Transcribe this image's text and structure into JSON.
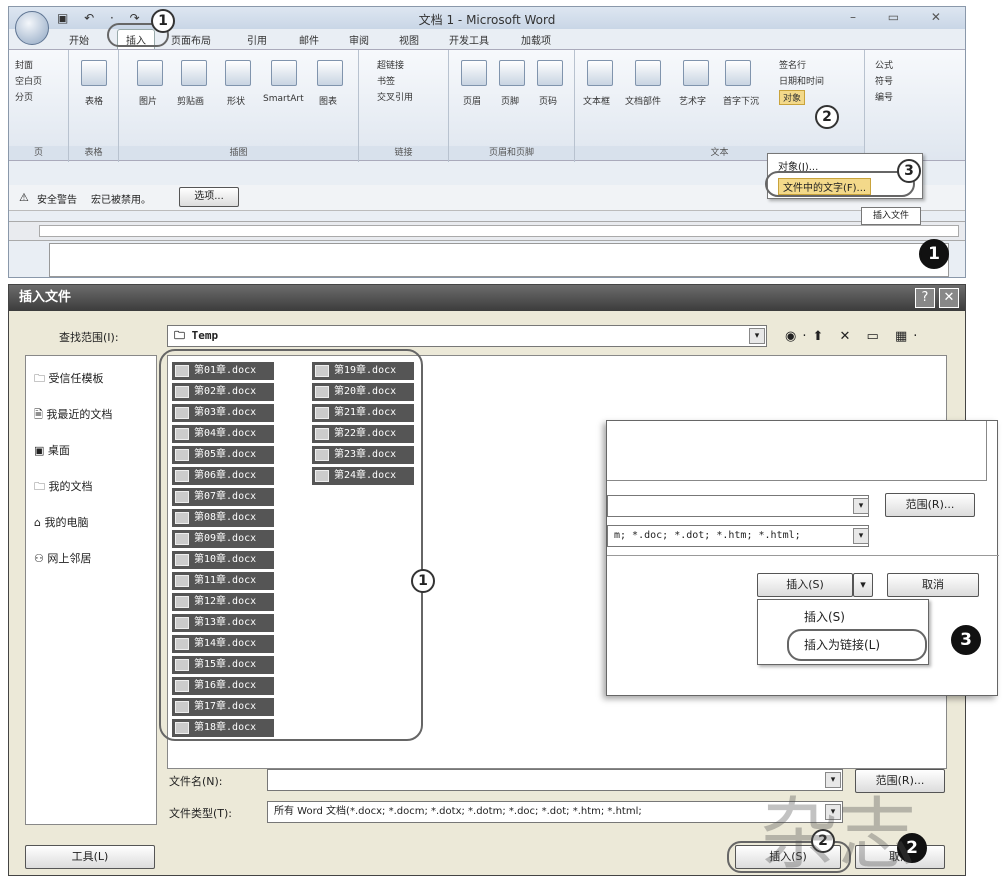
{
  "word": {
    "title": "文档 1 - Microsoft Word",
    "tabs": [
      "开始",
      "插入",
      "页面布局",
      "引用",
      "邮件",
      "审阅",
      "视图",
      "开发工具",
      "加载项"
    ],
    "groups": {
      "pages": {
        "label": "页",
        "items": [
          "封面",
          "空白页",
          "分页"
        ]
      },
      "tables": {
        "label": "表格",
        "button": "表格"
      },
      "illustrations": {
        "label": "插图",
        "buttons": [
          "图片",
          "剪贴画",
          "形状",
          "SmartArt",
          "图表"
        ]
      },
      "links": {
        "label": "链接",
        "items": [
          "超链接",
          "书签",
          "交叉引用"
        ]
      },
      "header_footer": {
        "label": "页眉和页脚",
        "buttons": [
          "页眉",
          "页脚",
          "页码"
        ]
      },
      "text": {
        "label": "文本",
        "buttons": [
          "文本框",
          "文档部件",
          "艺术字",
          "首字下沉"
        ],
        "items": [
          "签名行",
          "日期和时间",
          "对象"
        ]
      },
      "symbols": {
        "items": [
          "公式",
          "符号",
          "编号"
        ]
      }
    },
    "security_warning": "安全警告",
    "security_msg": "宏已被禁用。",
    "security_options": "选项...",
    "object_menu": [
      "对象(J)...",
      "文件中的文字(F)..."
    ],
    "tooltip": "插入文件"
  },
  "dialog": {
    "title": "插入文件",
    "look_in_label": "查找范围(I):",
    "look_in_value": "Temp",
    "places": [
      "受信任模板",
      "我最近的文档",
      "桌面",
      "我的文档",
      "我的电脑",
      "网上邻居"
    ],
    "files_col1": [
      "第01章.docx",
      "第02章.docx",
      "第03章.docx",
      "第04章.docx",
      "第05章.docx",
      "第06章.docx",
      "第07章.docx",
      "第08章.docx",
      "第09章.docx",
      "第10章.docx",
      "第11章.docx",
      "第12章.docx",
      "第13章.docx",
      "第14章.docx",
      "第15章.docx",
      "第16章.docx",
      "第17章.docx",
      "第18章.docx"
    ],
    "files_col2": [
      "第19章.docx",
      "第20章.docx",
      "第21章.docx",
      "第22章.docx",
      "第23章.docx",
      "第24章.docx"
    ],
    "filename_label": "文件名(N):",
    "filename_value": "",
    "filetype_label": "文件类型(T):",
    "filetype_value": "所有 Word 文档(*.docx; *.docm; *.dotx; *.dotm; *.doc; *.dot; *.htm; *.html;",
    "range_button": "范围(R)...",
    "tools_button": "工具(L)",
    "insert_button": "插入(S)",
    "cancel_button": "取消"
  },
  "inset": {
    "range_button": "范围(R)...",
    "filetype_value": "m; *.doc; *.dot; *.htm; *.html;",
    "insert_button": "插入(S)",
    "cancel_button": "取消",
    "menu": [
      "插入(S)",
      "插入为链接(L)"
    ]
  },
  "callouts": {
    "c1": "1",
    "c2": "2",
    "c3": "3"
  },
  "watermark": "杂志"
}
